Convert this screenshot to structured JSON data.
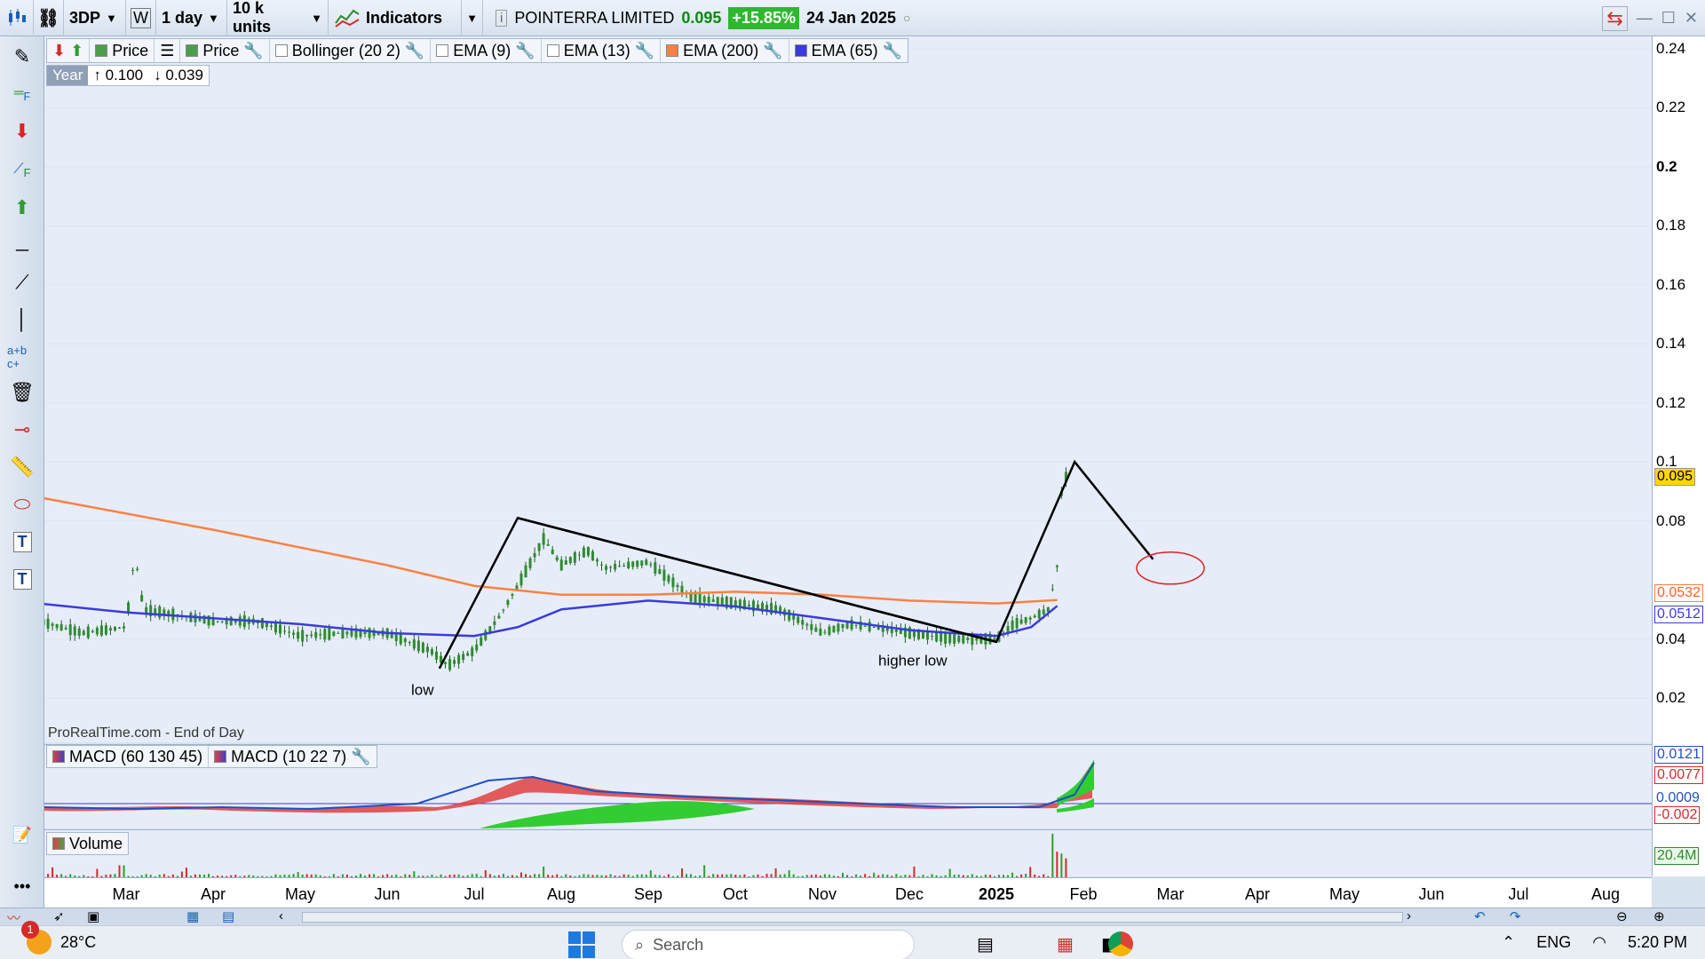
{
  "toolbar": {
    "ticker": "3DP",
    "mode": "W",
    "timeframe": "1 day",
    "units": "10 k units",
    "indicators": "Indicators",
    "company": "POINTERRA LIMITED",
    "price": "0.095",
    "change": "+15.85%",
    "date": "24 Jan 2025"
  },
  "legend": {
    "price1": "Price",
    "price2": "Price",
    "bollinger": "Bollinger (20 2)",
    "ema9": "EMA (9)",
    "ema13": "EMA (13)",
    "ema200": "EMA (200)",
    "ema65": "EMA (65)"
  },
  "year_box": {
    "label": "Year",
    "high": "0.100",
    "low": "0.039"
  },
  "annotations": {
    "low": "low",
    "higher_low": "higher low"
  },
  "footer": "ProRealTime.com - End of Day",
  "macd": {
    "legend1": "MACD (60 130 45)",
    "legend2": "MACD (10 22 7)",
    "axis": [
      "0.0121",
      "0.0077",
      "0.0009",
      "-0.002"
    ]
  },
  "volume": {
    "legend": "Volume",
    "axis": "20.4M"
  },
  "price_labels": {
    "current": "0.095",
    "ema200": "0.0532",
    "ema65": "0.0512"
  },
  "colors": {
    "ema200": "#ff8040",
    "ema65": "#3a3adf",
    "up_candle": "#2e8b2e",
    "current_price_bg": "#ffd700",
    "macd_fill": "#33cc33"
  },
  "chart_data": {
    "type": "line",
    "title": "",
    "xlabel": "",
    "ylabel": "",
    "ylim": [
      0.0,
      0.24
    ],
    "y_ticks": [
      "0.24",
      "0.22",
      "0.2",
      "0.18",
      "0.16",
      "0.14",
      "0.12",
      "0.1",
      "0.08",
      "0.04",
      "0.02"
    ],
    "x_ticks": [
      "Mar",
      "Apr",
      "May",
      "Jun",
      "Jul",
      "Aug",
      "Sep",
      "Oct",
      "Nov",
      "Dec",
      "2025",
      "Feb",
      "Mar",
      "Apr",
      "May",
      "Jun",
      "Jul",
      "Aug"
    ],
    "x_tick_pos": [
      2,
      3,
      4,
      5,
      6,
      7,
      8,
      9,
      10,
      11,
      12,
      13,
      14,
      15,
      16,
      17,
      18,
      19
    ],
    "x_range": [
      1.0,
      19.5
    ],
    "series": [
      {
        "name": "EMA (200)",
        "x": [
          1.0,
          3.0,
          5.0,
          6.0,
          7.0,
          8.0,
          9.0,
          10.0,
          11.0,
          12.0,
          12.7
        ],
        "values": [
          0.088,
          0.077,
          0.065,
          0.058,
          0.055,
          0.055,
          0.056,
          0.055,
          0.053,
          0.052,
          0.0532
        ]
      },
      {
        "name": "EMA (65)",
        "x": [
          1.0,
          2.0,
          3.0,
          4.0,
          5.0,
          6.0,
          6.5,
          7.0,
          8.0,
          9.0,
          10.0,
          11.0,
          12.0,
          12.4,
          12.7
        ],
        "values": [
          0.052,
          0.049,
          0.047,
          0.045,
          0.042,
          0.041,
          0.044,
          0.05,
          0.053,
          0.051,
          0.047,
          0.043,
          0.041,
          0.044,
          0.0512
        ]
      },
      {
        "name": "Price",
        "x": [
          1.0,
          1.5,
          2.0,
          2.1,
          2.2,
          3.0,
          3.5,
          4.0,
          4.5,
          5.0,
          5.5,
          5.7,
          6.0,
          6.3,
          6.5,
          6.8,
          7.0,
          7.3,
          7.5,
          8.0,
          8.5,
          9.0,
          9.5,
          10.0,
          10.3,
          10.6,
          11.0,
          11.5,
          12.0,
          12.2,
          12.4,
          12.6,
          12.7,
          12.75,
          12.8
        ],
        "values": [
          0.046,
          0.042,
          0.044,
          0.069,
          0.05,
          0.046,
          0.046,
          0.041,
          0.042,
          0.042,
          0.036,
          0.031,
          0.036,
          0.048,
          0.058,
          0.074,
          0.065,
          0.07,
          0.064,
          0.066,
          0.054,
          0.052,
          0.05,
          0.042,
          0.045,
          0.044,
          0.042,
          0.04,
          0.04,
          0.045,
          0.047,
          0.05,
          0.065,
          0.09,
          0.095
        ]
      }
    ],
    "drawn_lines": [
      {
        "x": [
          5.6,
          6.5,
          12.0,
          12.9,
          13.8
        ],
        "values": [
          0.03,
          0.081,
          0.039,
          0.1,
          0.067
        ]
      },
      {
        "x": [
          6.5,
          12.0
        ],
        "values": [
          0.081,
          0.039
        ]
      }
    ]
  }
}
